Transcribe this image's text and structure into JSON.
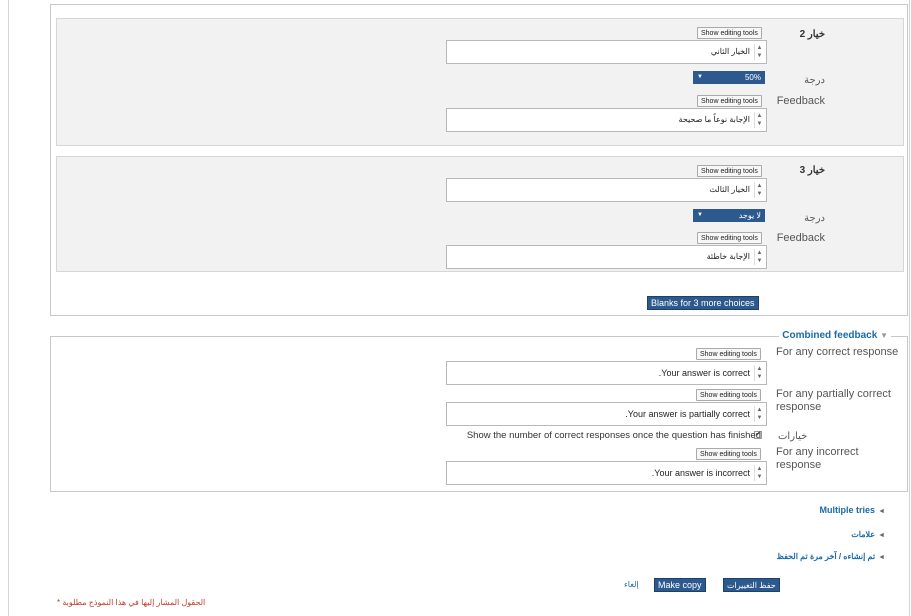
{
  "choices": [
    {
      "label": "خيار 2",
      "edit_tools": "Show editing tools",
      "answer": "الخيار الثاني",
      "grade_label": "درجة",
      "grade_value": "50%",
      "feedback_label": "Feedback",
      "feedback_value": "الإجابة نوعاً ما صحيحة"
    },
    {
      "label": "خيار 3",
      "edit_tools": "Show editing tools",
      "answer": "الخيار الثالث",
      "grade_label": "درجة",
      "grade_value": "لا يوجد",
      "feedback_label": "Feedback",
      "feedback_value": "الإجابة خاطئة"
    }
  ],
  "blanks_button": "Blanks for 3 more choices",
  "combined": {
    "legend": "Combined feedback",
    "chev": "▼",
    "edit_tools": "Show editing tools",
    "correct_label": "For any correct response",
    "correct_value": ".Your answer is correct",
    "partial_label": "For any partially correct response",
    "partial_value": ".Your answer is partially correct",
    "options_label": "خيارات",
    "show_num_text": "Show the number of correct responses once the question has finished",
    "show_num_checked": true,
    "incorrect_label": "For any incorrect response",
    "incorrect_value": ".Your answer is incorrect"
  },
  "sections": {
    "multiple_tries": "Multiple tries",
    "tags": "علامات",
    "created": "تم إنشاءه / آخر مرة تم الحفظ"
  },
  "actions": {
    "save": "حفظ التغييرات",
    "make_copy": "Make copy",
    "cancel": "إلغاء"
  },
  "required_note": "الحقول المشار إليها في هذا النموذج مطلوبة",
  "required_star": "*",
  "icons": {
    "dropdown": "▼",
    "spin_up": "▲",
    "spin_down": "▼",
    "section_triangle": "◄",
    "checkmark": "✔"
  }
}
